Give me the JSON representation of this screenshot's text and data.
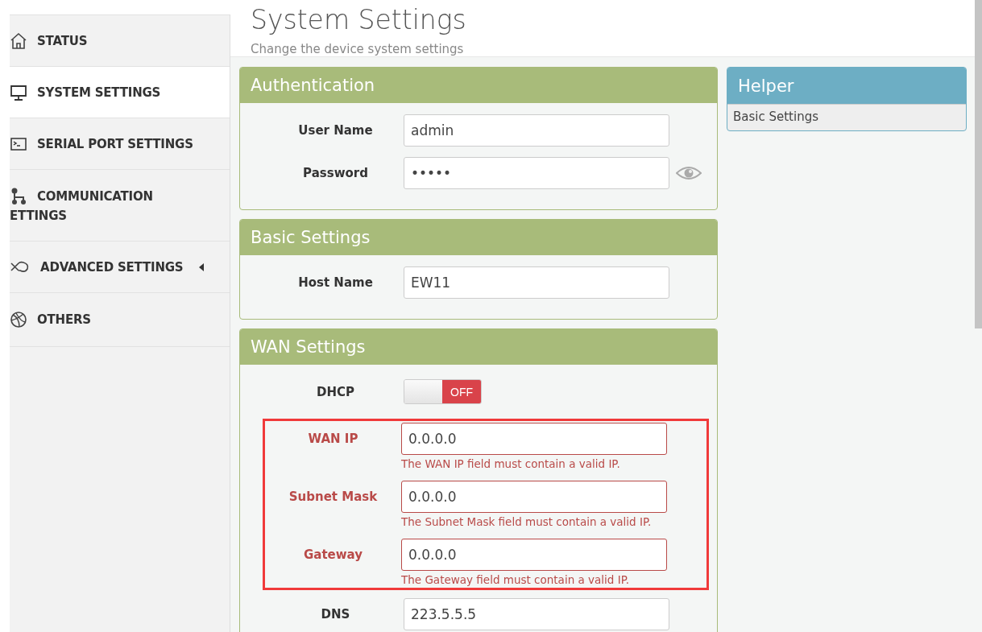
{
  "sidebar": {
    "items": [
      {
        "label_lines": [
          "STATUS"
        ],
        "selected": false,
        "caret": false
      },
      {
        "label_lines": [
          "SYSTEM SETTINGS"
        ],
        "selected": true,
        "caret": false
      },
      {
        "label_lines": [
          "SERIAL PORT SETTINGS"
        ],
        "selected": false,
        "caret": false
      },
      {
        "label_lines": [
          "COMMUNICATION",
          "ETTINGS"
        ],
        "selected": false,
        "caret": false
      },
      {
        "label_lines": [
          "ADVANCED SETTINGS"
        ],
        "selected": false,
        "caret": true
      },
      {
        "label_lines": [
          "OTHERS"
        ],
        "selected": false,
        "caret": false
      }
    ]
  },
  "header": {
    "title": "System Settings",
    "subtitle": "Change the device system settings"
  },
  "panels": [
    {
      "title": "Authentication",
      "rows": [
        {
          "kind": "text",
          "label": "User Name",
          "value": "admin",
          "error": false
        },
        {
          "kind": "password",
          "label": "Password",
          "value": "•••••",
          "error": false
        }
      ]
    },
    {
      "title": "Basic Settings",
      "rows": [
        {
          "kind": "text",
          "label": "Host Name",
          "value": "EW11",
          "error": false
        }
      ]
    },
    {
      "title": "WAN Settings",
      "highlight": true,
      "rows": [
        {
          "kind": "switch",
          "label": "DHCP",
          "on": false,
          "state_text": "OFF"
        },
        {
          "kind": "text",
          "label": "WAN IP",
          "value": "0.0.0.0",
          "error": true,
          "help": "The WAN IP field must contain a valid IP."
        },
        {
          "kind": "text",
          "label": "Subnet Mask",
          "value": "0.0.0.0",
          "error": true,
          "help": "The Subnet Mask field must contain a valid IP."
        },
        {
          "kind": "text",
          "label": "Gateway",
          "value": "0.0.0.0",
          "error": true,
          "help": "The Gateway field must contain a valid IP."
        },
        {
          "kind": "text",
          "label": "DNS",
          "value": "223.5.5.5",
          "error": false
        }
      ]
    }
  ],
  "helper": {
    "title": "Helper",
    "body": "Basic Settings"
  }
}
